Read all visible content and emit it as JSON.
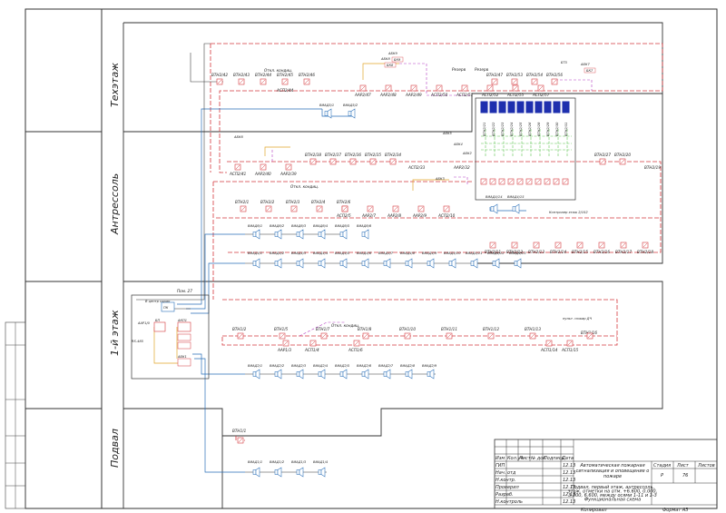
{
  "floors": {
    "tech": "Техэтаж",
    "mezz": "Антрессоль",
    "first": "1-й этаж",
    "basement": "Подвал"
  },
  "tech": {
    "btns_top": [
      "ВТН2/42",
      "ВТН2/43",
      "ВТН2/44",
      "ВТН2/45",
      "ВТН2/46",
      "ВТН2/47",
      "ВТН2/53",
      "ВТН2/54",
      "ВТН2/56"
    ],
    "btns_bot": [
      "ААР2/47",
      "ААР2/48",
      "ААР2/49",
      "АСП2/50",
      "АСП2/51",
      "АСП2/52",
      "АСП2/55",
      "АСП2/57"
    ],
    "otkl": "Откл. кондиц.",
    "acp": "АСП2/44",
    "rezerv1": "Резерв",
    "rezerv2": "Резерв",
    "abk": [
      "АБК8",
      "АБК9",
      "АБК7"
    ],
    "bk": [
      "БК8",
      "БК9",
      "БК7"
    ],
    "spk": [
      "ВИАД5/1",
      "ВИАД5/2"
    ],
    "bts": "БТ5"
  },
  "mezz": {
    "row1": [
      "ВТН2/38",
      "ВТН2/37",
      "ВТН2/36",
      "ВТН2/35",
      "ВТН2/34",
      "ВТН2/27",
      "ВТН2/20"
    ],
    "row1b": [
      "АСП2/41",
      "ААР2/40",
      "ААР2/39",
      "АСП2/33",
      "ААР2/32",
      "ВТН2/19"
    ],
    "row2": [
      "ВТН2/1",
      "ВТН2/2",
      "ВТН2/3",
      "ВТН2/4",
      "ВТН2/6",
      "ВТН2/11",
      "ВТН2/12",
      "ВТН2/13",
      "ВТН2/14",
      "ВТН2/15",
      "ВТН2/16",
      "ВТН2/17",
      "ВТН2/18"
    ],
    "row2b": [
      "АСП2/5",
      "ААР2/7",
      "ААР2/8",
      "ААР2/9",
      "АСП2/10"
    ],
    "otkl": "Откл. кондиц.",
    "abk": [
      "АБК6",
      "АБК5",
      "АБК4",
      "АБК3",
      "АБК2"
    ],
    "kontr": "Контролер\nэтаж 2/102",
    "vert": [
      "ВТН2/21",
      "ВТН2/22",
      "ВТН2/23",
      "ВТН2/24",
      "ВТН2/25",
      "ВТН2/26",
      "ВТН2/28",
      "ВТН2/29",
      "ВТН2/30",
      "ВТН2/31"
    ],
    "spk_top": [
      "ВИАД6/1",
      "ВИАД6/2",
      "ВИАД6/3",
      "ВИАД6/4",
      "ВИАД6/5",
      "ВИАД6/6"
    ],
    "spk_mid": [
      "ВИАД4/1",
      "ВИАД4/2",
      "ВИАД4/3",
      "ВИАД4/4",
      "ВИАД4/5",
      "ВИАД4/6",
      "ВИАД4/7",
      "ВИАД4/8",
      "ВИАД4/9",
      "ВИАД4/10",
      "ВИАД4/11",
      "ВИАД4/12",
      "ВИАД4/13"
    ],
    "spk_r": [
      "ВИАД4/14",
      "ВИАД4/15"
    ]
  },
  "first": {
    "pom": "Пом. 27",
    "centr": "В центр\nохран",
    "pk": "ПК",
    "aar": "ААР1/0",
    "bp": "БП",
    "akp": "АКП1",
    "rs": "RS-485",
    "abk": "АБК1",
    "row": [
      "ВТН1/2",
      "ВТН1/5",
      "ВТН1/7",
      "ВТН1/8",
      "ВТН1/10",
      "ВТН1/11",
      "ВТН1/12",
      "ВТН1/13",
      "ВТН1/16"
    ],
    "row_b": [
      "ААР1/3",
      "АСП1/4",
      "АСП1/6",
      "АСП1/14",
      "АСП1/15"
    ],
    "otkl": "Откл. кондиц.",
    "pult": "пульт. пожар\nДЧ",
    "spk": [
      "ВИАД2/1",
      "ВИАД2/2",
      "ВИАД2/3",
      "ВИАД2/4",
      "ВИАД2/5",
      "ВИАД2/6",
      "ВИАД2/7",
      "ВИАД2/8",
      "ВИАД2/9"
    ]
  },
  "basement": {
    "btn": "ВТН1/1",
    "spk": [
      "ВИАД1/1",
      "ВИАД1/2",
      "ВИАД1/3",
      "ВИАД1/4"
    ]
  },
  "stamp": {
    "hdr": [
      "Изм",
      "Кол.уч",
      "Лист",
      "№ док",
      "Подпись",
      "Дата"
    ],
    "roles": [
      "ГИП",
      "Нач. отд",
      "Н.контр.",
      "Проверил",
      "Разраб.",
      "Н.контроль"
    ],
    "title": "Автоматическая пожарная\nсигнализация и оповещение о\nпожаре",
    "subtitle": "Подвал, первый этаж, антрессоль,\nэтаж. отметки на отм. +6.600, 0.000,\n3.300, 6.600, между осями 1-11 и 1-3\nФункциональная схема",
    "stadia": "Стадия",
    "list": "Лист",
    "listov": "Листов",
    "stadia_v": "Р",
    "list_v": "76",
    "copied": "Копировал",
    "format": "Формат А3",
    "date": "12.13"
  }
}
